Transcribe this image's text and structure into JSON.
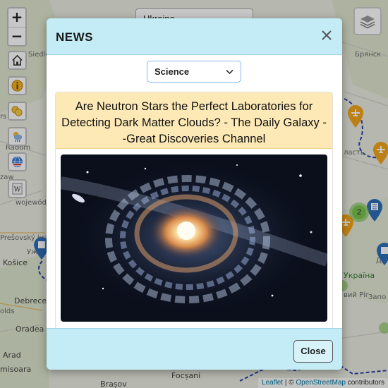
{
  "map": {
    "country_select_value": "Ukraine",
    "zoom_in": "+",
    "zoom_out": "−",
    "labels": {
      "bryansk": "Брянск",
      "radom": "Radom",
      "sidelce": "Siedlce",
      "rs": "rs",
      "wojewodztwo": "wojewódz",
      "ukraina": "Україна",
      "dn": "Дн",
      "vyi_rih": "вий Ріг",
      "zapo": "Запо",
      "kosice": "Košice",
      "debrecen": "Debrecen",
      "oradea": "Oradea",
      "arad": "Arad",
      "misoara": "misoara",
      "brasov": "Brașov",
      "focsani": "Focșani",
      "uzh": "Уж",
      "presov": "Prešovský kraj",
      "las": "ласть",
      "ar": "ar",
      "ols": "olds",
      "ezaw": "zaw"
    },
    "cluster_count": "2",
    "attribution": {
      "leaflet": "Leaflet",
      "separator": " | © ",
      "osm": "OpenStreetMap",
      "suffix": " contributors"
    }
  },
  "modal": {
    "title": "NEWS",
    "category_value": "Science",
    "news_title": "Are Neutron Stars the Perfect Laboratories for Detecting Dark Matter Clouds? - The Daily Galaxy --Great Discoveries Channel",
    "close_label": "Close"
  },
  "colors": {
    "header_bg": "#c3ecf6",
    "title_bg": "#fde9b6",
    "accent_blue": "#86b7fe",
    "marker_orange": "#f3a51c",
    "marker_blue": "#2f6fb7",
    "cluster_green": "#7cc24f"
  }
}
